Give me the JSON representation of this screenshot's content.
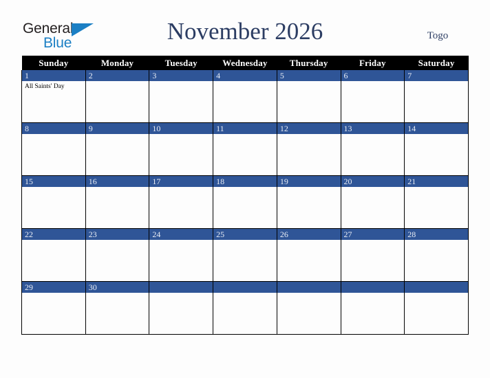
{
  "brand": {
    "name_part1": "General",
    "name_part2": "Blue",
    "triangle_color": "#1b7fc4",
    "text_color": "#231f20"
  },
  "header": {
    "title": "November 2026",
    "country": "Togo",
    "title_color": "#2c3d63"
  },
  "calendar": {
    "weekday_headers": [
      "Sunday",
      "Monday",
      "Tuesday",
      "Wednesday",
      "Thursday",
      "Friday",
      "Saturday"
    ],
    "header_bg": "#000000",
    "daybar_bg": "#2f5597",
    "daybar_text": "#e9edf5",
    "weeks": [
      [
        {
          "day": "1",
          "events": [
            "All Saints' Day"
          ]
        },
        {
          "day": "2",
          "events": []
        },
        {
          "day": "3",
          "events": []
        },
        {
          "day": "4",
          "events": []
        },
        {
          "day": "5",
          "events": []
        },
        {
          "day": "6",
          "events": []
        },
        {
          "day": "7",
          "events": []
        }
      ],
      [
        {
          "day": "8",
          "events": []
        },
        {
          "day": "9",
          "events": []
        },
        {
          "day": "10",
          "events": []
        },
        {
          "day": "11",
          "events": []
        },
        {
          "day": "12",
          "events": []
        },
        {
          "day": "13",
          "events": []
        },
        {
          "day": "14",
          "events": []
        }
      ],
      [
        {
          "day": "15",
          "events": []
        },
        {
          "day": "16",
          "events": []
        },
        {
          "day": "17",
          "events": []
        },
        {
          "day": "18",
          "events": []
        },
        {
          "day": "19",
          "events": []
        },
        {
          "day": "20",
          "events": []
        },
        {
          "day": "21",
          "events": []
        }
      ],
      [
        {
          "day": "22",
          "events": []
        },
        {
          "day": "23",
          "events": []
        },
        {
          "day": "24",
          "events": []
        },
        {
          "day": "25",
          "events": []
        },
        {
          "day": "26",
          "events": []
        },
        {
          "day": "27",
          "events": []
        },
        {
          "day": "28",
          "events": []
        }
      ],
      [
        {
          "day": "29",
          "events": []
        },
        {
          "day": "30",
          "events": []
        },
        {
          "day": "",
          "events": []
        },
        {
          "day": "",
          "events": []
        },
        {
          "day": "",
          "events": []
        },
        {
          "day": "",
          "events": []
        },
        {
          "day": "",
          "events": []
        }
      ]
    ]
  }
}
